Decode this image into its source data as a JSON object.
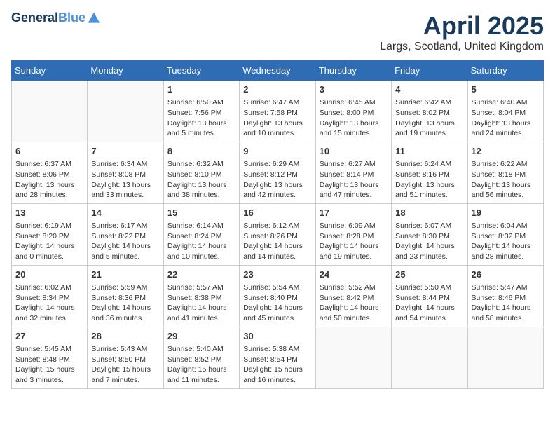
{
  "header": {
    "logo_line1": "General",
    "logo_line2": "Blue",
    "month": "April 2025",
    "location": "Largs, Scotland, United Kingdom"
  },
  "weekdays": [
    "Sunday",
    "Monday",
    "Tuesday",
    "Wednesday",
    "Thursday",
    "Friday",
    "Saturday"
  ],
  "weeks": [
    [
      {
        "day": "",
        "info": ""
      },
      {
        "day": "",
        "info": ""
      },
      {
        "day": "1",
        "info": "Sunrise: 6:50 AM\nSunset: 7:56 PM\nDaylight: 13 hours and 5 minutes."
      },
      {
        "day": "2",
        "info": "Sunrise: 6:47 AM\nSunset: 7:58 PM\nDaylight: 13 hours and 10 minutes."
      },
      {
        "day": "3",
        "info": "Sunrise: 6:45 AM\nSunset: 8:00 PM\nDaylight: 13 hours and 15 minutes."
      },
      {
        "day": "4",
        "info": "Sunrise: 6:42 AM\nSunset: 8:02 PM\nDaylight: 13 hours and 19 minutes."
      },
      {
        "day": "5",
        "info": "Sunrise: 6:40 AM\nSunset: 8:04 PM\nDaylight: 13 hours and 24 minutes."
      }
    ],
    [
      {
        "day": "6",
        "info": "Sunrise: 6:37 AM\nSunset: 8:06 PM\nDaylight: 13 hours and 28 minutes."
      },
      {
        "day": "7",
        "info": "Sunrise: 6:34 AM\nSunset: 8:08 PM\nDaylight: 13 hours and 33 minutes."
      },
      {
        "day": "8",
        "info": "Sunrise: 6:32 AM\nSunset: 8:10 PM\nDaylight: 13 hours and 38 minutes."
      },
      {
        "day": "9",
        "info": "Sunrise: 6:29 AM\nSunset: 8:12 PM\nDaylight: 13 hours and 42 minutes."
      },
      {
        "day": "10",
        "info": "Sunrise: 6:27 AM\nSunset: 8:14 PM\nDaylight: 13 hours and 47 minutes."
      },
      {
        "day": "11",
        "info": "Sunrise: 6:24 AM\nSunset: 8:16 PM\nDaylight: 13 hours and 51 minutes."
      },
      {
        "day": "12",
        "info": "Sunrise: 6:22 AM\nSunset: 8:18 PM\nDaylight: 13 hours and 56 minutes."
      }
    ],
    [
      {
        "day": "13",
        "info": "Sunrise: 6:19 AM\nSunset: 8:20 PM\nDaylight: 14 hours and 0 minutes."
      },
      {
        "day": "14",
        "info": "Sunrise: 6:17 AM\nSunset: 8:22 PM\nDaylight: 14 hours and 5 minutes."
      },
      {
        "day": "15",
        "info": "Sunrise: 6:14 AM\nSunset: 8:24 PM\nDaylight: 14 hours and 10 minutes."
      },
      {
        "day": "16",
        "info": "Sunrise: 6:12 AM\nSunset: 8:26 PM\nDaylight: 14 hours and 14 minutes."
      },
      {
        "day": "17",
        "info": "Sunrise: 6:09 AM\nSunset: 8:28 PM\nDaylight: 14 hours and 19 minutes."
      },
      {
        "day": "18",
        "info": "Sunrise: 6:07 AM\nSunset: 8:30 PM\nDaylight: 14 hours and 23 minutes."
      },
      {
        "day": "19",
        "info": "Sunrise: 6:04 AM\nSunset: 8:32 PM\nDaylight: 14 hours and 28 minutes."
      }
    ],
    [
      {
        "day": "20",
        "info": "Sunrise: 6:02 AM\nSunset: 8:34 PM\nDaylight: 14 hours and 32 minutes."
      },
      {
        "day": "21",
        "info": "Sunrise: 5:59 AM\nSunset: 8:36 PM\nDaylight: 14 hours and 36 minutes."
      },
      {
        "day": "22",
        "info": "Sunrise: 5:57 AM\nSunset: 8:38 PM\nDaylight: 14 hours and 41 minutes."
      },
      {
        "day": "23",
        "info": "Sunrise: 5:54 AM\nSunset: 8:40 PM\nDaylight: 14 hours and 45 minutes."
      },
      {
        "day": "24",
        "info": "Sunrise: 5:52 AM\nSunset: 8:42 PM\nDaylight: 14 hours and 50 minutes."
      },
      {
        "day": "25",
        "info": "Sunrise: 5:50 AM\nSunset: 8:44 PM\nDaylight: 14 hours and 54 minutes."
      },
      {
        "day": "26",
        "info": "Sunrise: 5:47 AM\nSunset: 8:46 PM\nDaylight: 14 hours and 58 minutes."
      }
    ],
    [
      {
        "day": "27",
        "info": "Sunrise: 5:45 AM\nSunset: 8:48 PM\nDaylight: 15 hours and 3 minutes."
      },
      {
        "day": "28",
        "info": "Sunrise: 5:43 AM\nSunset: 8:50 PM\nDaylight: 15 hours and 7 minutes."
      },
      {
        "day": "29",
        "info": "Sunrise: 5:40 AM\nSunset: 8:52 PM\nDaylight: 15 hours and 11 minutes."
      },
      {
        "day": "30",
        "info": "Sunrise: 5:38 AM\nSunset: 8:54 PM\nDaylight: 15 hours and 16 minutes."
      },
      {
        "day": "",
        "info": ""
      },
      {
        "day": "",
        "info": ""
      },
      {
        "day": "",
        "info": ""
      }
    ]
  ]
}
